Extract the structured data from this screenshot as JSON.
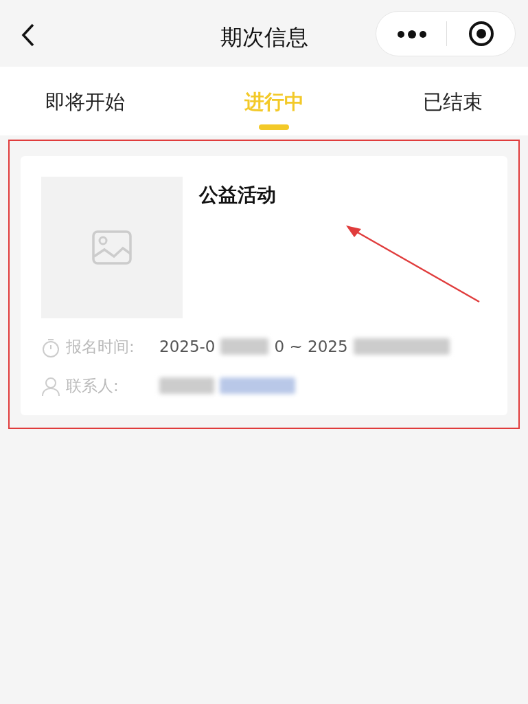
{
  "header": {
    "title": "期次信息"
  },
  "tabs": [
    {
      "label": "即将开始",
      "selected": false
    },
    {
      "label": "进行中",
      "selected": true
    },
    {
      "label": "已结束",
      "selected": false
    }
  ],
  "card": {
    "title": "公益活动",
    "time_label": "报名时间:",
    "time_start": "2025-0",
    "time_mid": "0 ~ 2025",
    "contact_label": "联系人:"
  }
}
